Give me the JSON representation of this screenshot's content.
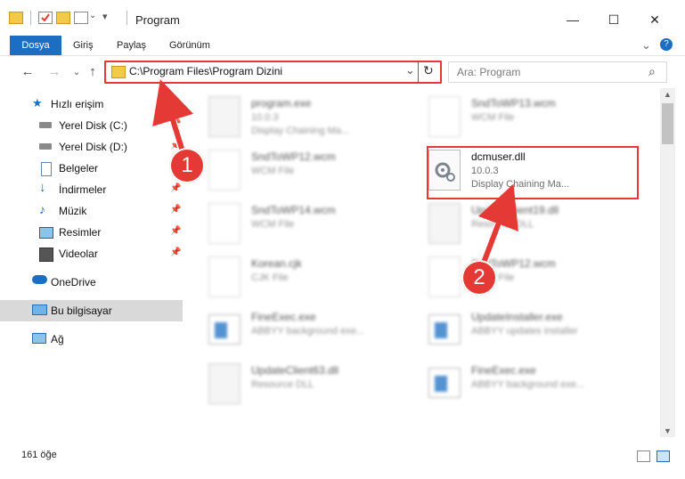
{
  "window": {
    "title": "Program",
    "minimize": "—",
    "maximize": "☐",
    "close": "✕"
  },
  "ribbon": {
    "tabs": [
      "Dosya",
      "Giriş",
      "Paylaş",
      "Görünüm"
    ],
    "expand": "⌄",
    "help": "?"
  },
  "nav": {
    "back": "←",
    "forward": "→",
    "recent": "⌄",
    "up": "↑",
    "address": "C:\\Program Files\\Program Dizini",
    "address_dropdown": "⌄",
    "refresh": "↻",
    "search_placeholder": "Ara: Program",
    "search_icon": "⌕"
  },
  "sidebar": {
    "items": [
      {
        "label": "Hızlı erişim",
        "icon": "star-icon"
      },
      {
        "label": "Yerel Disk (C:)",
        "icon": "drive-icon"
      },
      {
        "label": "Yerel Disk (D:)",
        "icon": "drive-icon"
      },
      {
        "label": "Belgeler",
        "icon": "document-icon"
      },
      {
        "label": "İndirmeler",
        "icon": "download-icon"
      },
      {
        "label": "Müzik",
        "icon": "music-icon"
      },
      {
        "label": "Resimler",
        "icon": "pictures-icon"
      },
      {
        "label": "Videolar",
        "icon": "video-icon"
      },
      {
        "label": "OneDrive",
        "icon": "cloud-icon"
      },
      {
        "label": "Bu bilgisayar",
        "icon": "computer-icon"
      },
      {
        "label": "Ağ",
        "icon": "network-icon"
      }
    ]
  },
  "files": [
    {
      "name": "program.exe",
      "line2": "10.0.3",
      "line3": "Display Chaining Ma..."
    },
    {
      "name": "SndToWP13.wcm",
      "line2": "WCM File",
      "line3": ""
    },
    {
      "name": "SndToWP12.wcm",
      "line2": "WCM File",
      "line3": ""
    },
    {
      "name": "dcmuser.dll",
      "line2": "10.0.3",
      "line3": "Display Chaining Ma..."
    },
    {
      "name": "SndToWP14.wcm",
      "line2": "WCM File",
      "line3": ""
    },
    {
      "name": "UpdateClient19.dll",
      "line2": "Resource DLL",
      "line3": ""
    },
    {
      "name": "Korean.cjk",
      "line2": "CJK File",
      "line3": ""
    },
    {
      "name": "SndToWP12.wcm",
      "line2": "WCM File",
      "line3": ""
    },
    {
      "name": "FineExec.exe",
      "line2": "ABBYY background exe...",
      "line3": ""
    },
    {
      "name": "UpdateInstaller.exe",
      "line2": "ABBYY updates installer",
      "line3": ""
    },
    {
      "name": "UpdateClient63.dll",
      "line2": "Resource DLL",
      "line3": ""
    },
    {
      "name": "FineExec.exe",
      "line2": "ABBYY background exe...",
      "line3": ""
    }
  ],
  "status": {
    "count": "161 öğe"
  },
  "annotations": {
    "step1": "1",
    "step2": "2"
  },
  "colors": {
    "accent": "#1b6ec2",
    "annotation": "#e53935",
    "selected_bg": "#d9d9d9"
  }
}
